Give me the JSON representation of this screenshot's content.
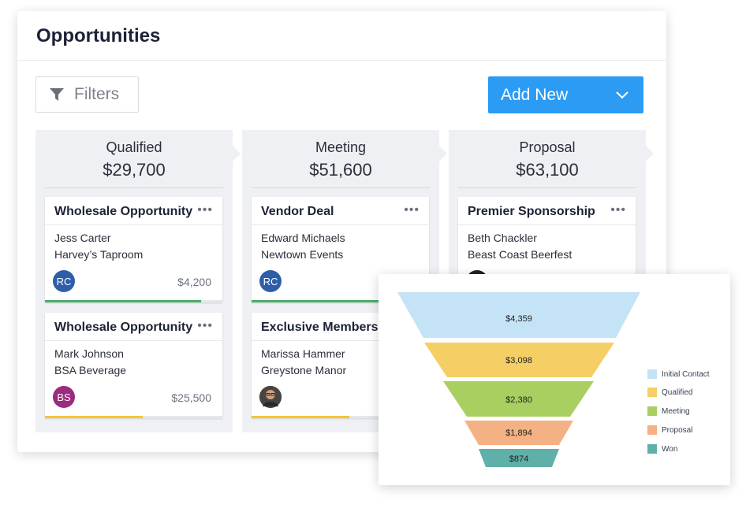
{
  "panel": {
    "title": "Opportunities"
  },
  "toolbar": {
    "filters_label": "Filters",
    "add_new_label": "Add New",
    "filter_icon": "filter-icon",
    "chevron_icon": "chevron-down-icon"
  },
  "columns": [
    {
      "name": "Qualified",
      "amount": "$29,700",
      "cards": [
        {
          "title": "Wholesale Opportunity",
          "contact": "Jess Carter",
          "company": "Harvey’s Taproom",
          "initials": "RC",
          "avatar_color": "#2f5ea8",
          "amount": "$4,200",
          "progress": 0.88,
          "bar_color": "#4cae6a"
        },
        {
          "title": "Wholesale Opportunity",
          "contact": "Mark Johnson",
          "company": "BSA Beverage",
          "initials": "BS",
          "avatar_color": "#9c2a7e",
          "amount": "$25,500",
          "progress": 0.55,
          "bar_color": "#f4c631"
        }
      ]
    },
    {
      "name": "Meeting",
      "amount": "$51,600",
      "cards": [
        {
          "title": "Vendor Deal",
          "contact": "Edward Michaels",
          "company": "Newtown Events",
          "initials": "RC",
          "avatar_color": "#2f5ea8",
          "amount": "",
          "progress": 0.8,
          "bar_color": "#4cae6a"
        },
        {
          "title": "Exclusive Membership",
          "contact": "Marissa Hammer",
          "company": "Greystone Manor",
          "initials": "",
          "avatar_color": "#3a3a3a",
          "amount": "",
          "progress": 0.55,
          "bar_color": "#f4c631"
        }
      ]
    },
    {
      "name": "Proposal",
      "amount": "$63,100",
      "cards": [
        {
          "title": "Premier Sponsorship",
          "contact": "Beth Chackler",
          "company": "Beast Coast Beerfest",
          "initials": "",
          "avatar_color": "#222222",
          "amount": "",
          "progress": 0,
          "bar_color": "#4cae6a"
        }
      ]
    }
  ],
  "funnel": {
    "stages": [
      {
        "label": "Initial Contact",
        "value": "$4,359",
        "color": "#c5e3f7"
      },
      {
        "label": "Qualified",
        "value": "$3,098",
        "color": "#f5cf66"
      },
      {
        "label": "Meeting",
        "value": "$2,380",
        "color": "#a8cf5f"
      },
      {
        "label": "Proposal",
        "value": "$1,894",
        "color": "#f4b183"
      },
      {
        "label": "Won",
        "value": "$874",
        "color": "#5fb0a8"
      }
    ]
  }
}
